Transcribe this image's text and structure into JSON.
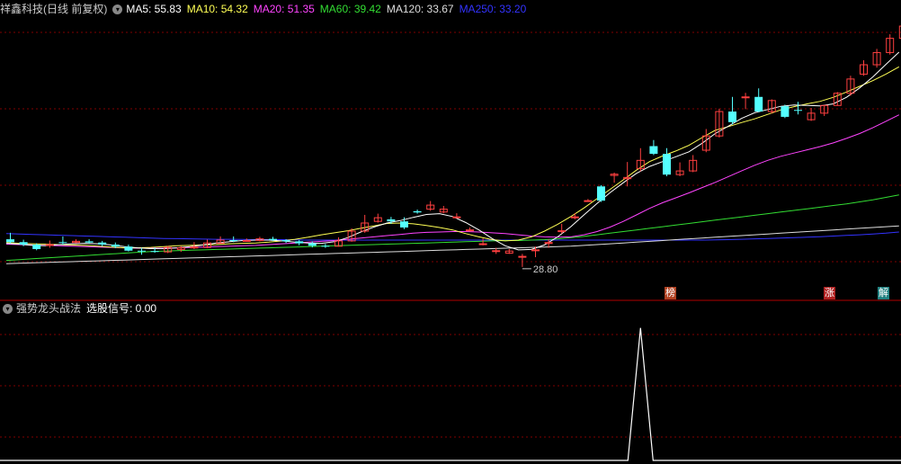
{
  "main_header": {
    "title": "祥鑫科技(日线 前复权)",
    "ma": [
      {
        "label": "MA5: 55.83",
        "color": "#ffffff"
      },
      {
        "label": "MA10: 54.32",
        "color": "#ffff55"
      },
      {
        "label": "MA20: 51.35",
        "color": "#ff44ff"
      },
      {
        "label": "MA60: 39.42",
        "color": "#33dd33"
      },
      {
        "label": "MA120: 33.67",
        "color": "#dddddd"
      },
      {
        "label": "MA250: 33.20",
        "color": "#3333ff"
      }
    ]
  },
  "sub_header": {
    "title": "强势龙头战法",
    "signal": "选股信号: 0.00"
  },
  "annotations": {
    "low_label": "28.80",
    "tags": [
      "榜",
      "涨",
      "解"
    ]
  },
  "colors": {
    "up": "#ff4040",
    "down": "#54ffff",
    "grid": "#800000",
    "separator": "#b00000"
  },
  "chart_data": {
    "type": "candlestick",
    "x": [
      0,
      1,
      2,
      3,
      4,
      5,
      6,
      7,
      8,
      9,
      10,
      11,
      12,
      13,
      14,
      15,
      16,
      17,
      18,
      19,
      20,
      21,
      22,
      23,
      24,
      25,
      26,
      27,
      28,
      29,
      30,
      31,
      32,
      33,
      34,
      35,
      36,
      37,
      38,
      39,
      40,
      41,
      42,
      43,
      44,
      45,
      46,
      47,
      48,
      49,
      50,
      51,
      52,
      53,
      54,
      55,
      56,
      57,
      58,
      59,
      60,
      61,
      62,
      63,
      64,
      65,
      66,
      67,
      68
    ],
    "open": [
      35.6,
      34.9,
      34.3,
      34.1,
      34.9,
      34.8,
      35.1,
      34.8,
      34.3,
      33.8,
      32.8,
      32.7,
      32.5,
      33.1,
      33.5,
      33.6,
      34.6,
      35.4,
      35.2,
      35.3,
      35.7,
      35.4,
      35.1,
      34.6,
      34.0,
      33.9,
      35.2,
      37.6,
      40.0,
      40.5,
      40.0,
      42.5,
      43.0,
      42.3,
      41.1,
      37.9,
      34.5,
      32.8,
      32.2,
      31.4,
      33.0,
      34.8,
      37.7,
      41.1,
      45.1,
      48.6,
      51.3,
      50.5,
      53.0,
      58.5,
      56.6,
      51.5,
      52.4,
      57.5,
      61.0,
      67.0,
      70.5,
      70.6,
      67.0,
      68.3,
      67.4,
      65.0,
      66.6,
      68.5,
      71.5,
      76.2,
      78.5,
      81.5,
      85.0
    ],
    "close": [
      34.9,
      34.3,
      33.2,
      34.3,
      34.8,
      35.1,
      34.8,
      34.3,
      33.8,
      32.8,
      32.7,
      32.5,
      33.6,
      33.5,
      33.7,
      34.7,
      35.4,
      35.2,
      35.3,
      35.7,
      35.4,
      35.1,
      34.6,
      34.0,
      33.9,
      35.2,
      37.6,
      39.6,
      40.9,
      40.0,
      38.5,
      42.2,
      44.0,
      43.0,
      41.1,
      37.9,
      34.5,
      32.8,
      32.7,
      31.4,
      33.0,
      34.8,
      37.7,
      41.1,
      45.1,
      45.1,
      51.6,
      50.8,
      55.0,
      56.6,
      51.5,
      52.4,
      55.0,
      61.0,
      67.0,
      64.4,
      70.6,
      67.0,
      69.7,
      65.7,
      67.3,
      66.6,
      68.5,
      71.5,
      75.0,
      78.5,
      81.5,
      85.0,
      88.0
    ],
    "high": [
      37.2,
      35.5,
      34.6,
      35.3,
      36.3,
      35.6,
      35.6,
      35.2,
      34.8,
      34.3,
      33.5,
      33.6,
      34.0,
      33.9,
      34.9,
      35.5,
      36.3,
      36.3,
      35.8,
      36.2,
      36.2,
      35.6,
      35.4,
      35.1,
      34.5,
      36.1,
      38.3,
      41.6,
      41.9,
      41.1,
      41.0,
      42.9,
      45.0,
      43.8,
      42.0,
      38.5,
      35.8,
      33.5,
      33.2,
      32.0,
      33.8,
      35.6,
      39.4,
      42.0,
      45.5,
      48.9,
      52.0,
      54.6,
      58.0,
      60.0,
      58.0,
      54.5,
      56.3,
      62.7,
      67.7,
      70.6,
      71.6,
      72.7,
      70.0,
      68.7,
      69.4,
      67.9,
      68.5,
      71.8,
      75.8,
      79.6,
      82.4,
      86.0,
      88.0
    ],
    "low": [
      34.6,
      33.9,
      32.9,
      33.5,
      34.3,
      34.6,
      34.5,
      33.9,
      33.4,
      32.6,
      31.8,
      32.3,
      32.2,
      32.5,
      33.2,
      33.4,
      34.5,
      34.9,
      35.0,
      35.1,
      35.2,
      34.7,
      34.1,
      33.6,
      33.5,
      33.8,
      35.0,
      37.2,
      39.7,
      39.4,
      38.1,
      41.9,
      42.6,
      42.0,
      40.9,
      37.5,
      34.1,
      32.0,
      32.0,
      28.8,
      31.2,
      33.5,
      37.0,
      40.5,
      44.8,
      44.8,
      49.5,
      48.6,
      52.3,
      56.3,
      51.1,
      51.1,
      52.1,
      57.0,
      60.6,
      63.8,
      67.6,
      66.8,
      66.5,
      65.4,
      66.3,
      64.7,
      65.9,
      68.4,
      70.9,
      75.8,
      77.8,
      81.0,
      84.5
    ],
    "MA5": 55.83,
    "MA10": 54.32,
    "MA20": 51.35,
    "MA60": 39.42,
    "MA120": 33.67,
    "MA250": 33.2,
    "ma_series": {
      "MA250": [
        37.0,
        36.9,
        36.8,
        36.7,
        36.6,
        36.5,
        36.4,
        36.3,
        36.2,
        36.1,
        36.0,
        35.9,
        35.8,
        35.75,
        35.7,
        35.65,
        35.6,
        35.6,
        35.55,
        35.5,
        35.5,
        35.5,
        35.45,
        35.4,
        35.4,
        35.4,
        35.4,
        35.4,
        35.4,
        35.4,
        35.4,
        35.4,
        35.4,
        35.4,
        35.4,
        35.4,
        35.4,
        35.4,
        35.4,
        35.4,
        35.4,
        35.4,
        35.4,
        35.4,
        35.4,
        35.4,
        35.4,
        35.4,
        35.4,
        35.4,
        35.4,
        35.4,
        35.4,
        35.4,
        35.45,
        35.5,
        35.6,
        35.7,
        35.8,
        35.9,
        36.0,
        36.1,
        36.25,
        36.4,
        36.55,
        36.7,
        36.9,
        37.1,
        37.4
      ],
      "MA120": [
        29.6,
        29.7,
        29.8,
        29.9,
        30.0,
        30.1,
        30.2,
        30.3,
        30.4,
        30.5,
        30.6,
        30.7,
        30.8,
        30.9,
        31.0,
        31.1,
        31.2,
        31.3,
        31.4,
        31.5,
        31.6,
        31.7,
        31.8,
        31.9,
        32.0,
        32.1,
        32.2,
        32.3,
        32.4,
        32.5,
        32.6,
        32.7,
        32.8,
        32.9,
        33.0,
        33.1,
        33.2,
        33.3,
        33.4,
        33.5,
        33.6,
        33.7,
        33.8,
        33.9,
        34.1,
        34.3,
        34.5,
        34.7,
        34.9,
        35.1,
        35.3,
        35.5,
        35.7,
        35.9,
        36.1,
        36.3,
        36.5,
        36.7,
        36.9,
        37.1,
        37.3,
        37.5,
        37.7,
        37.9,
        38.1,
        38.3,
        38.5,
        38.7,
        38.9
      ],
      "MA60": [
        30.4,
        30.6,
        30.8,
        31.0,
        31.2,
        31.4,
        31.6,
        31.8,
        32.0,
        32.2,
        32.4,
        32.6,
        32.7,
        32.8,
        32.9,
        33.0,
        33.1,
        33.2,
        33.3,
        33.4,
        33.5,
        33.6,
        33.7,
        33.8,
        33.9,
        34.0,
        34.1,
        34.2,
        34.3,
        34.4,
        34.5,
        34.6,
        34.7,
        34.8,
        34.9,
        35.0,
        35.1,
        35.2,
        35.3,
        35.3,
        35.4,
        35.5,
        35.7,
        36.0,
        36.3,
        36.7,
        37.1,
        37.5,
        37.9,
        38.3,
        38.7,
        39.1,
        39.5,
        39.9,
        40.3,
        40.7,
        41.1,
        41.5,
        41.9,
        42.3,
        42.7,
        43.1,
        43.5,
        43.9,
        44.3,
        44.8,
        45.3,
        45.9,
        46.5
      ],
      "MA20": [
        34.4,
        34.3,
        34.2,
        34.1,
        34.0,
        33.9,
        33.8,
        33.7,
        33.6,
        33.5,
        33.4,
        33.4,
        33.4,
        33.5,
        33.6,
        33.7,
        33.8,
        33.9,
        34.0,
        34.1,
        34.3,
        34.5,
        34.7,
        34.9,
        35.1,
        35.3,
        35.6,
        35.9,
        36.2,
        36.5,
        36.8,
        37.1,
        37.3,
        37.4,
        37.5,
        37.5,
        37.4,
        37.2,
        37.0,
        36.7,
        36.4,
        36.2,
        36.1,
        36.2,
        36.7,
        37.5,
        38.6,
        40.0,
        41.6,
        43.2,
        44.6,
        45.8,
        47.0,
        48.3,
        49.6,
        51.0,
        52.4,
        53.8,
        55.0,
        56.0,
        56.8,
        57.6,
        58.4,
        59.3,
        60.4,
        61.6,
        63.0,
        64.6,
        66.2
      ],
      "MA10": [
        34.8,
        34.6,
        34.5,
        34.4,
        34.3,
        34.2,
        34.1,
        33.9,
        33.7,
        33.5,
        33.5,
        33.6,
        33.8,
        34.0,
        34.1,
        34.2,
        34.3,
        34.5,
        34.6,
        34.7,
        34.9,
        35.2,
        35.6,
        36.1,
        36.7,
        37.2,
        37.7,
        38.3,
        38.9,
        39.5,
        39.6,
        39.4,
        39.0,
        38.5,
        37.9,
        37.0,
        36.2,
        35.5,
        35.2,
        35.4,
        36.2,
        37.6,
        39.3,
        41.2,
        43.3,
        45.6,
        47.9,
        50.2,
        52.6,
        54.7,
        56.1,
        57.3,
        58.7,
        60.6,
        62.4,
        63.3,
        64.3,
        65.2,
        66.3,
        67.4,
        68.2,
        68.9,
        69.5,
        70.5,
        71.8,
        73.2,
        74.6,
        76.2,
        78.0
      ],
      "MA5": [
        34.6,
        34.4,
        34.1,
        34.0,
        34.3,
        34.5,
        34.6,
        34.5,
        34.2,
        33.8,
        33.5,
        33.3,
        33.3,
        33.5,
        33.8,
        34.2,
        34.7,
        35.0,
        35.3,
        35.4,
        35.4,
        35.2,
        34.9,
        34.7,
        34.6,
        35.0,
        36.0,
        37.4,
        38.6,
        39.6,
        40.2,
        41.0,
        41.7,
        41.9,
        41.2,
        39.7,
        37.9,
        35.8,
        34.0,
        33.0,
        33.1,
        34.2,
        36.2,
        38.7,
        41.6,
        44.4,
        47.1,
        49.5,
        51.8,
        53.5,
        54.7,
        55.9,
        57.1,
        59.2,
        61.6,
        63.4,
        65.3,
        66.7,
        67.5,
        68.3,
        68.6,
        68.5,
        68.4,
        68.9,
        70.5,
        72.8,
        75.5,
        78.6,
        81.6
      ]
    },
    "low_marker": {
      "index": 39,
      "value": 28.8
    },
    "ylim": [
      27,
      90
    ],
    "indicator": {
      "name": "强势龙头战法",
      "series": "选股信号",
      "value": 0.0,
      "values": [
        0,
        0,
        0,
        0,
        0,
        0,
        0,
        0,
        0,
        0,
        0,
        0,
        0,
        0,
        0,
        0,
        0,
        0,
        0,
        0,
        0,
        0,
        0,
        0,
        0,
        0,
        0,
        0,
        0,
        0,
        0,
        0,
        0,
        0,
        0,
        0,
        0,
        0,
        0,
        0,
        0,
        0,
        0,
        0,
        0,
        0,
        0,
        0,
        0,
        0,
        0,
        0,
        0,
        0,
        0,
        0,
        0,
        0,
        0,
        0,
        0,
        0,
        0,
        0,
        0,
        0,
        0,
        0,
        0
      ],
      "spike_index": 48,
      "spike_value": 1,
      "ylim": [
        0,
        1.1
      ]
    }
  }
}
